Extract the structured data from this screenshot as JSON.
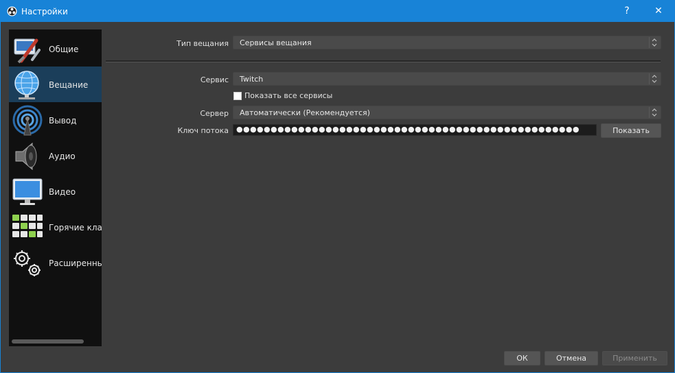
{
  "window": {
    "title": "Настройки",
    "help_label": "?",
    "close_label": "✕",
    "accent": "#1883d7"
  },
  "sidebar": {
    "items": [
      {
        "label": "Общие",
        "icon": "general-wrench-screwdriver-icon"
      },
      {
        "label": "Вещание",
        "icon": "stream-globe-icon",
        "selected": true
      },
      {
        "label": "Вывод",
        "icon": "output-antenna-icon"
      },
      {
        "label": "Аудио",
        "icon": "audio-speaker-icon"
      },
      {
        "label": "Видео",
        "icon": "video-monitor-icon"
      },
      {
        "label": "Горячие клавиши",
        "icon": "hotkeys-keyboard-icon"
      },
      {
        "label": "Расширенные",
        "icon": "advanced-gears-icon"
      }
    ]
  },
  "stream": {
    "type_label": "Тип вещания",
    "type_value": "Сервисы вещания",
    "service_label": "Сервис",
    "service_value": "Twitch",
    "show_all_label": "Показать все сервисы",
    "show_all_checked": false,
    "server_label": "Сервер",
    "server_value": "Автоматически (Рекомендуется)",
    "key_label": "Ключ потока",
    "key_value": "●●●●●●●●●●●●●●●●●●●●●●●●●●●●●●●●●●●●●●●●●●●●●●●●●●",
    "show_key_button": "Показать"
  },
  "footer": {
    "ok": "ОК",
    "cancel": "Отмена",
    "apply": "Применить"
  }
}
